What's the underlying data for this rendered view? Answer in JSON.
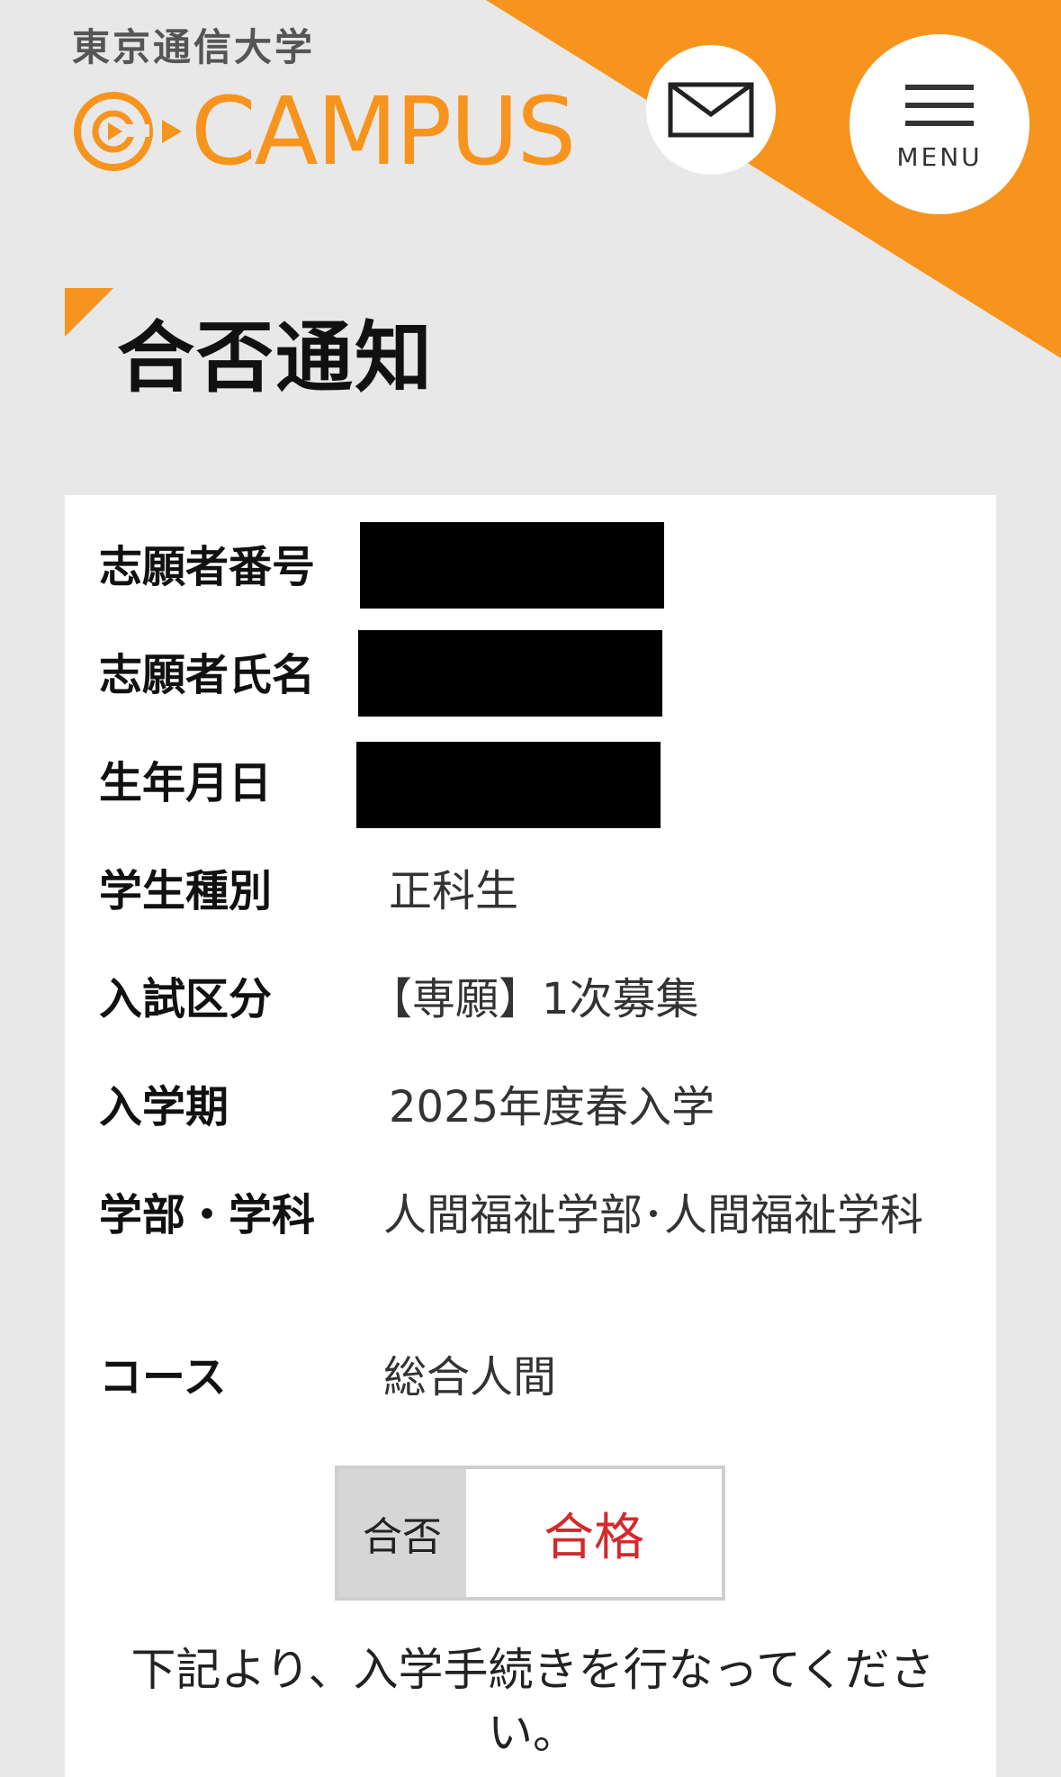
{
  "header": {
    "university_name": "東京通信大学",
    "brand_name": "CAMPUS",
    "menu_label": "MENU",
    "accent_color": "#f7941d"
  },
  "page": {
    "title": "合否通知"
  },
  "details": [
    {
      "label": "志願者番号",
      "value": null,
      "redacted": true
    },
    {
      "label": "志願者氏名",
      "value": null,
      "redacted": true
    },
    {
      "label": "生年月日",
      "value": null,
      "redacted": true
    },
    {
      "label": "学生種別",
      "value": "正科生"
    },
    {
      "label": "入試区分",
      "value": "【専願】1次募集"
    },
    {
      "label": "入学期",
      "value": "2025年度春入学"
    },
    {
      "label": "学部・学科",
      "value": "人間福祉学部･人間福祉学科"
    },
    {
      "label": "コース",
      "value": "総合人間"
    }
  ],
  "result": {
    "label": "合否",
    "value": "合格",
    "value_color": "#d12b2b"
  },
  "notice": "下記より、入学手続きを行なってください。",
  "icons": [
    "mail-icon",
    "hamburger-icon",
    "at-play-icon",
    "arrow-right-icon"
  ]
}
